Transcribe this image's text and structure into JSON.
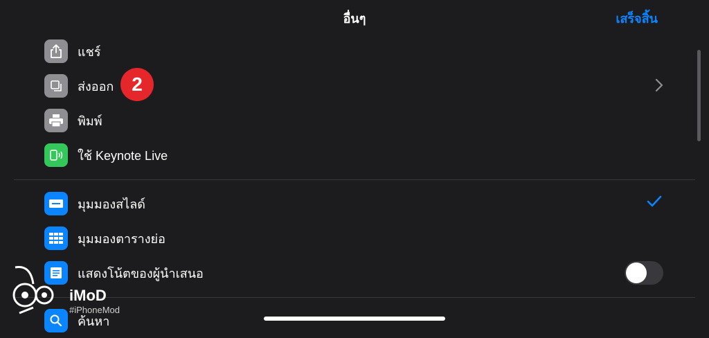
{
  "header": {
    "title": "อื่นๆ",
    "done_label": "เสร็จสิ้น"
  },
  "menu": {
    "share": "แชร์",
    "export": "ส่งออก",
    "print": "พิมพ์",
    "keynote_live": "ใช้ Keynote Live",
    "slide_view": "มุมมองสไลด์",
    "light_table": "มุมมองตารางย่อ",
    "presenter_notes": "แสดงโน้ตของผู้นำเสนอ",
    "find": "ค้นหา"
  },
  "state": {
    "selected_view": "slide_view",
    "presenter_notes_on": false
  },
  "annotation": {
    "step_badge": "2"
  },
  "watermark": {
    "brand": "iMoD",
    "handle": "#iPhoneMod"
  },
  "colors": {
    "background": "#1c1c1e",
    "accent": "#0a84ff",
    "badge": "#e5262b",
    "icon_gray": "#8e8e93",
    "icon_green": "#34c759",
    "icon_blue": "#0a84ff"
  },
  "icons": {
    "share": "share-icon",
    "export": "export-icon",
    "print": "print-icon",
    "keynote_live": "keynote-live-icon",
    "slide_view": "slide-view-icon",
    "light_table": "grid-icon",
    "presenter_notes": "notes-icon",
    "find": "search-icon"
  }
}
